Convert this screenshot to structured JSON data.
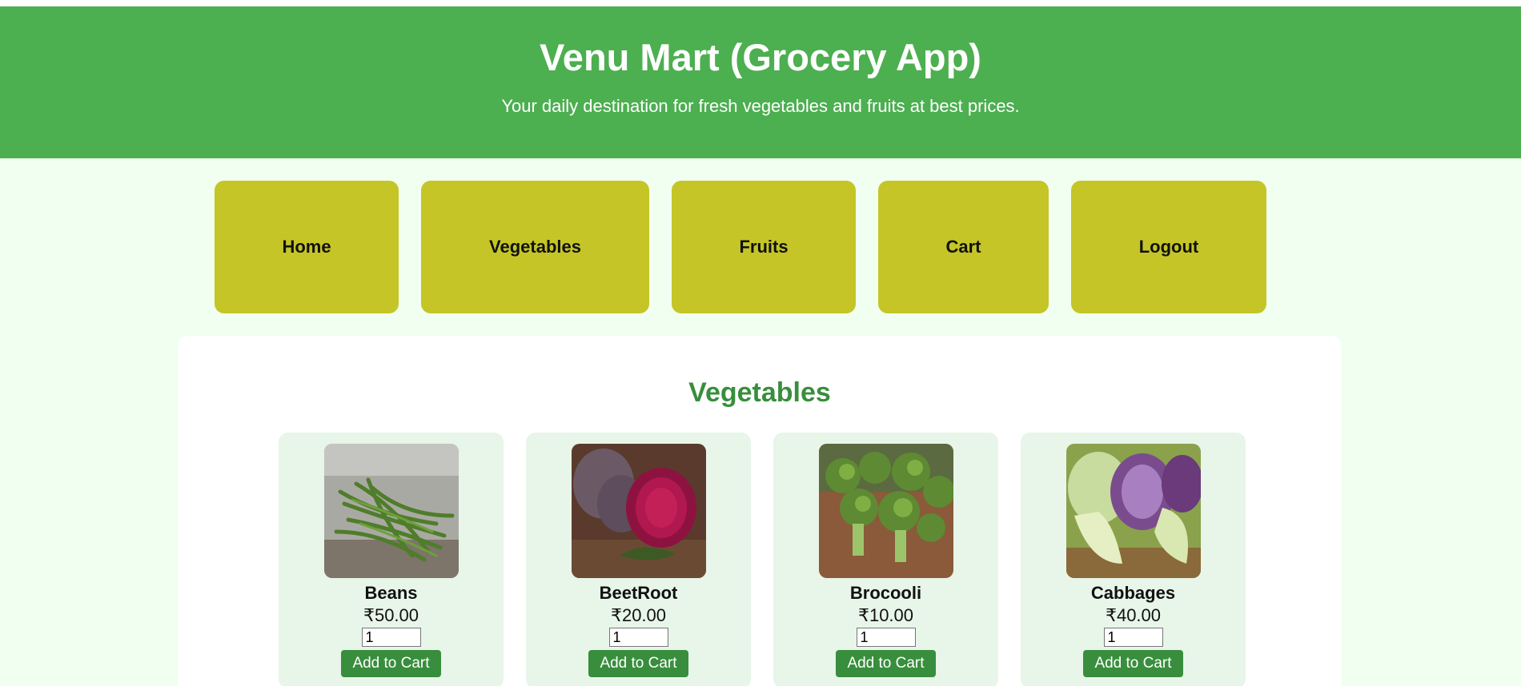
{
  "header": {
    "title": "Venu Mart (Grocery App)",
    "tagline": "Your daily destination for fresh vegetables and fruits at best prices."
  },
  "nav": [
    {
      "label": "Home"
    },
    {
      "label": "Vegetables"
    },
    {
      "label": "Fruits"
    },
    {
      "label": "Cart"
    },
    {
      "label": "Logout"
    }
  ],
  "section": {
    "title": "Vegetables"
  },
  "products": [
    {
      "name": "Beans",
      "price": "₹50.00",
      "qty": "1",
      "button": "Add to Cart",
      "image": "beans-photo"
    },
    {
      "name": "BeetRoot",
      "price": "₹20.00",
      "qty": "1",
      "button": "Add to Cart",
      "image": "beetroot-photo"
    },
    {
      "name": "Brocooli",
      "price": "₹10.00",
      "qty": "1",
      "button": "Add to Cart",
      "image": "broccoli-photo"
    },
    {
      "name": "Cabbages",
      "price": "₹40.00",
      "qty": "1",
      "button": "Add to Cart",
      "image": "cabbage-photo"
    }
  ],
  "colors": {
    "header_bg": "#4caf50",
    "nav_bg": "#c5c527",
    "page_bg": "#f0fff0",
    "card_bg": "#e8f5e9",
    "accent": "#388e3c"
  }
}
